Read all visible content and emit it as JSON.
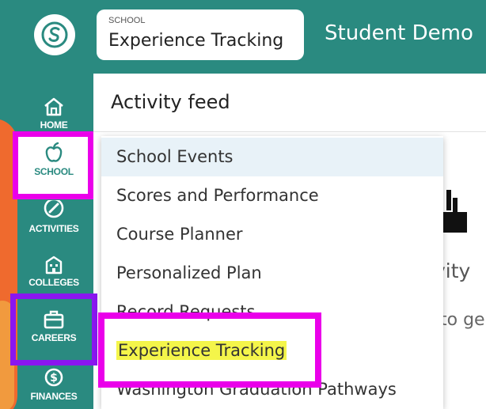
{
  "topbar": {
    "breadcrumb_small": "SCHOOL",
    "breadcrumb_title": "Experience Tracking",
    "page_title": "Student Demo"
  },
  "sidebar": {
    "items": [
      {
        "label": "HOME",
        "icon": "home-icon"
      },
      {
        "label": "SCHOOL",
        "icon": "apple-icon"
      },
      {
        "label": "ACTIVITIES",
        "icon": "activities-icon"
      },
      {
        "label": "COLLEGES",
        "icon": "college-icon"
      },
      {
        "label": "CAREERS",
        "icon": "briefcase-icon"
      },
      {
        "label": "FINANCES",
        "icon": "dollar-icon"
      }
    ]
  },
  "content": {
    "feed_title": "Activity feed",
    "partial_text_1": "vity",
    "partial_text_2": "to ge"
  },
  "menu": {
    "items": [
      "School Events",
      "Scores and Performance",
      "Course Planner",
      "Personalized Plan",
      "Record Requests",
      "Experience Tracking",
      "Washington Graduation Pathways"
    ]
  },
  "colors": {
    "teal": "#2a8a80",
    "magenta_highlight": "#ea00ea",
    "purple_highlight": "#8a16f0",
    "text_highlight": "#f4f54a",
    "orange": "#ef6a2e"
  }
}
